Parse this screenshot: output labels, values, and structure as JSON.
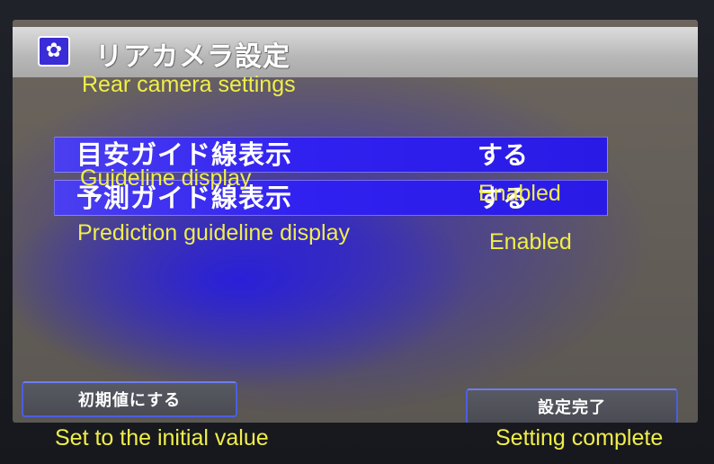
{
  "header": {
    "title": "リアカメラ設定",
    "title_translation": "Rear camera settings",
    "icon": "gear-icon"
  },
  "settings": [
    {
      "label": "目安ガイド線表示",
      "label_translation": "Guideline display",
      "value": "する",
      "value_translation": "Enabled"
    },
    {
      "label": "予測ガイド線表示",
      "label_translation": "Prediction guideline display",
      "value": "する",
      "value_translation": "Enabled"
    }
  ],
  "footer": {
    "reset_label": "初期値にする",
    "reset_translation": "Set to the initial value",
    "done_label": "設定完了",
    "done_translation": "Setting complete"
  },
  "colors": {
    "row_blue": "#3121f0",
    "annotation_yellow": "#f0ee4a",
    "title_bar": "#c4c4c4",
    "screen_bg": "#625d58"
  }
}
